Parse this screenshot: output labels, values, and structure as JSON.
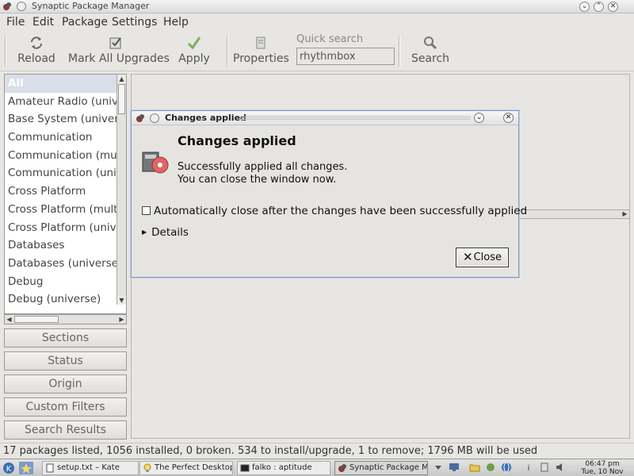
{
  "window": {
    "title": "Synaptic Package Manager"
  },
  "menu": [
    "File",
    "Edit",
    "Package",
    "Settings",
    "Help"
  ],
  "toolbar": {
    "reload": "Reload",
    "mark_all": "Mark All Upgrades",
    "apply": "Apply",
    "properties": "Properties",
    "quick_search_label": "Quick search",
    "quick_search_value": "rhythmbox",
    "search": "Search"
  },
  "sections": {
    "items": [
      "All",
      "Amateur Radio (univ",
      "Base System (univer",
      "Communication",
      "Communication (mu",
      "Communication (uni",
      "Cross Platform",
      "Cross Platform (mult",
      "Cross Platform (unive",
      "Databases",
      "Databases (universe)",
      "Debug",
      "Debug (universe)"
    ]
  },
  "filters": [
    "Sections",
    "Status",
    "Origin",
    "Custom Filters",
    "Search Results"
  ],
  "dialog": {
    "title": "Changes applied",
    "heading": "Changes applied",
    "message_line1": "Successfully applied all changes.",
    "message_line2": "You can close the window now.",
    "checkbox_label": "Automatically close after the changes have been successfully applied",
    "details": "Details",
    "close_button": "Close"
  },
  "status_bar": "17 packages listed, 1056 installed, 0 broken. 534 to install/upgrade, 1 to remove; 1796 MB will be used",
  "taskbar": {
    "tasks": [
      "setup.txt – Kate",
      "The Perfect Desktop",
      "falko : aptitude",
      "Synaptic Package Ma"
    ],
    "clock_time": "06:47 pm",
    "clock_date": "Tue, 10 Nov"
  }
}
